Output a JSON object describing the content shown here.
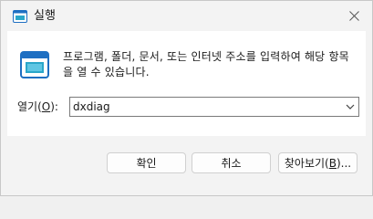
{
  "window": {
    "title": "실행",
    "close_glyph": "✕"
  },
  "dialog": {
    "description": "프로그램, 폴더, 문서, 또는 인터넷 주소를 입력하여 해당 항목을 열 수 있습니다.",
    "open_label_prefix": "열기(",
    "open_label_accel": "O",
    "open_label_suffix": "):",
    "open_value": "dxdiag"
  },
  "buttons": {
    "ok_label": "확인",
    "cancel_label": "취소",
    "browse_prefix": "찾아보기(",
    "browse_accel": "B",
    "browse_suffix": ")..."
  },
  "colors": {
    "icon_blue": "#1e6fc2",
    "icon_teal": "#2aa6c9",
    "border": "#7a7a7a"
  },
  "icons": {
    "title": "run-app-icon",
    "main": "run-app-icon",
    "close": "close-icon",
    "dropdown": "chevron-down-icon"
  }
}
